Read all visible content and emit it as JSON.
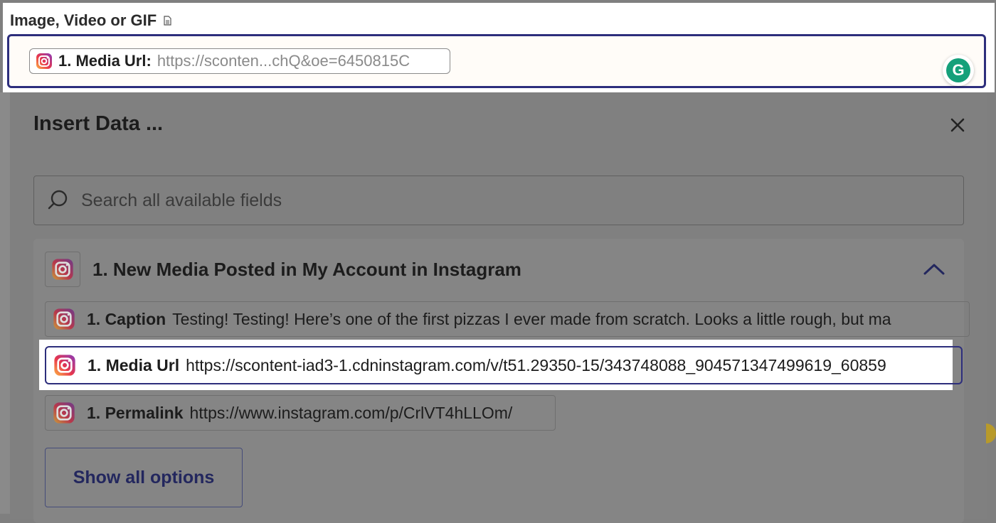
{
  "field": {
    "label": "Image, Video or GIF",
    "pill_key": "1. Media Url:",
    "pill_value": "https://sconten...chQ&oe=6450815C",
    "grammarly_letter": "G"
  },
  "panel": {
    "title": "Insert Data ...",
    "search_placeholder": "Search all available fields",
    "group": {
      "title": "1. New Media Posted in My Account in Instagram",
      "rows": [
        {
          "key": "1. Caption",
          "value": "Testing! Testing! Here’s one of the first pizzas I ever made from scratch. Looks a little rough, but ma"
        },
        {
          "key": "1. Media Url",
          "value": "https://scontent-iad3-1.cdninstagram.com/v/t51.29350-15/343748088_904571347499619_60859"
        },
        {
          "key": "1. Permalink",
          "value": "https://www.instagram.com/p/CrlVT4hLLOm/"
        }
      ],
      "show_all_label": "Show all options"
    }
  },
  "icons": [
    "doc-icon",
    "instagram-icon",
    "grammarly-icon",
    "close-icon",
    "search-icon",
    "chevron-up-icon"
  ],
  "colors": {
    "accent": "#2d2e7c",
    "overlay": "#7f7f7f",
    "grammarly": "#15a07a"
  }
}
